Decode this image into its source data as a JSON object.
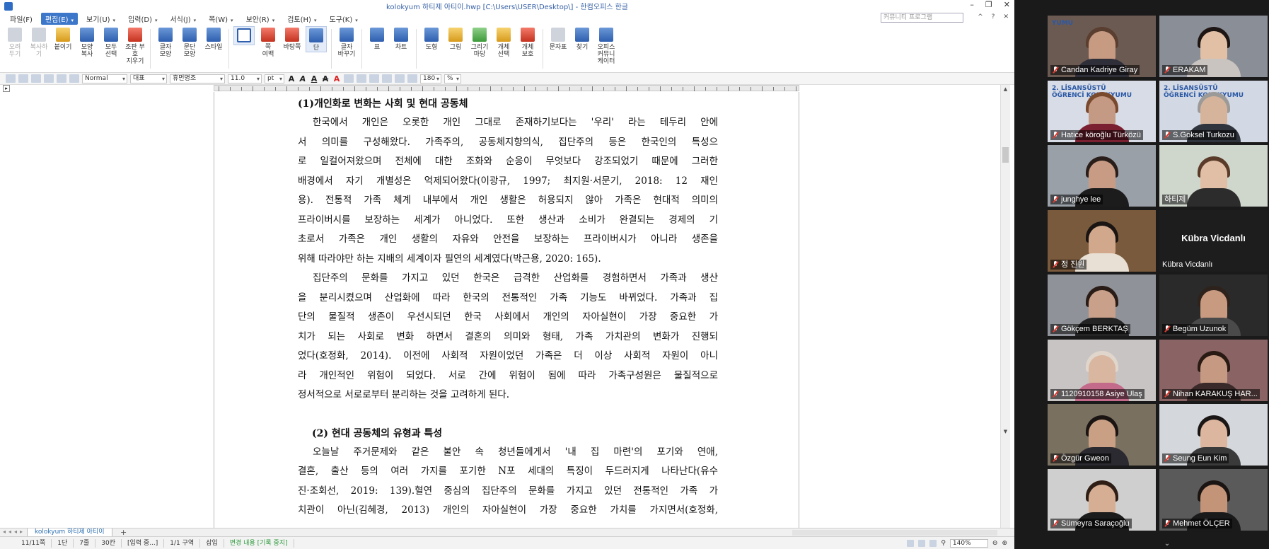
{
  "window": {
    "title": "kolokyum 하티제 아티이.hwp [C:\\Users\\USER\\Desktop\\] - 한컴오피스 한글",
    "controls": [
      "–",
      "❐",
      "✕"
    ]
  },
  "menu": {
    "items": [
      "파일(F)",
      "편집(E)",
      "보기(U)",
      "입력(D)",
      "서식(J)",
      "쪽(W)",
      "보안(R)",
      "검토(H)",
      "도구(K)"
    ],
    "active_index": 1,
    "community_placeholder": "커뮤니티 프로그램",
    "mini_controls": [
      "^",
      "?",
      "✕"
    ]
  },
  "ribbon": {
    "buttons": [
      {
        "label": "오려\n두기",
        "icon": "scissors-icon",
        "color": "gray",
        "disabled": true
      },
      {
        "label": "복사하기",
        "icon": "copy-icon",
        "color": "gray",
        "disabled": true
      },
      {
        "label": "붙이기",
        "icon": "paste-icon",
        "color": "gold"
      },
      {
        "label": "모양\n복사",
        "icon": "format-painter-icon",
        "color": "blue"
      },
      {
        "label": "모두\n선택",
        "icon": "select-all-icon",
        "color": "blue"
      },
      {
        "label": "조판 부호\n지우기",
        "icon": "erase-codes-icon",
        "color": "red"
      },
      {
        "sep": true
      },
      {
        "label": "글자\n모양",
        "icon": "char-shape-icon",
        "color": "blue"
      },
      {
        "label": "문단\n모양",
        "icon": "para-shape-icon",
        "color": "blue"
      },
      {
        "label": "스타일",
        "icon": "style-icon",
        "color": "blue"
      },
      {
        "sep": true
      },
      {
        "label": "",
        "icon": "page-layout-icon",
        "color": "outline",
        "selected": true
      },
      {
        "label": "쪽\n여백",
        "icon": "page-margin-icon",
        "color": "red"
      },
      {
        "label": "바탕쪽",
        "icon": "master-page-icon",
        "color": "red"
      },
      {
        "label": "단",
        "icon": "columns-icon",
        "color": "blue",
        "selected": true
      },
      {
        "sep": true
      },
      {
        "label": "글자\n바꾸기",
        "icon": "replace-char-icon",
        "color": "blue"
      },
      {
        "sep": true
      },
      {
        "label": "표",
        "icon": "table-icon",
        "color": "blue"
      },
      {
        "label": "차트",
        "icon": "chart-icon",
        "color": "blue"
      },
      {
        "sep": true
      },
      {
        "label": "도형",
        "icon": "shape-icon",
        "color": "blue"
      },
      {
        "label": "그림",
        "icon": "picture-icon",
        "color": "gold"
      },
      {
        "label": "그리기마당",
        "icon": "drawing-gallery-icon",
        "color": "green"
      },
      {
        "label": "개체\n선택",
        "icon": "object-select-icon",
        "color": "gold"
      },
      {
        "label": "개체\n보호",
        "icon": "object-protect-icon",
        "color": "red"
      },
      {
        "sep": true
      },
      {
        "label": "문자표",
        "icon": "symbol-icon",
        "color": "gray"
      },
      {
        "label": "찾기",
        "icon": "find-icon",
        "color": "blue"
      },
      {
        "label": "오피스\n커뮤니케이터",
        "icon": "communicator-icon",
        "color": "blue"
      }
    ]
  },
  "formatbar": {
    "style": "Normal",
    "lang": "대표",
    "font": "휴먼명조",
    "size": "11.0",
    "unit": "pt",
    "glyphs": [
      "A",
      "A",
      "A",
      "A",
      "A"
    ],
    "zoom": "180",
    "zoom_unit": "%"
  },
  "document": {
    "heading1": "(1)개인화로 변화는 사회 및 현대 공동체",
    "para1": [
      "한국에서 개인은 오롯한 개인 그대로 존재하기보다는 '우리' 라는 테두리 안에",
      "서 의미를 구성해왔다. 가족주의, 공동체지향의식, 집단주의 등은 한국인의 특성으",
      "로 일컬어져왔으며 전체에 대한 조화와 순응이 무엇보다 강조되었기 때문에 그러한",
      "배경에서 자기 개별성은 억제되어왔다(이광규, 1997; 최지원·서문기, 2018: 12 재인",
      "용). 전통적 가족 체계 내부에서 개인 생활은 허용되지 않아 가족은 현대적 의미의",
      "프라이버시를 보장하는 세계가 아니었다. 또한 생산과 소비가 완결되는 경제의 기",
      "초로서 가족은 개인 생활의 자유와 안전을 보장하는 프라이버시가 아니라 생존을",
      "위해 따라야만 하는 지배의 세계이자 필연의 세계였다(박근용, 2020: 165)."
    ],
    "para2": [
      "집단주의 문화를 가지고 있던 한국은 급격한 산업화를 경험하면서 가족과 생산",
      "을 분리시켰으며 산업화에 따라 한국의 전통적인 가족 기능도 바뀌었다. 가족과 집",
      "단의 물질적 생존이 우선시되던 한국 사회에서 개인의 자아실현이 가장 중요한 가",
      "치가 되는 사회로 변화 하면서 결혼의 의미와 형태, 가족 가치관의 변화가 진행되",
      "었다(호정화, 2014). 이전에 사회적 자원이었던 가족은 더 이상 사회적 자원이 아니",
      "라 개인적인 위험이 되었다. 서로 간에 위험이 됨에 따라 가족구성원은 물질적으로",
      "정서적으로 서로로부터 분리하는 것을 고려하게 된다."
    ],
    "heading2": "(2) 현대 공동체의 유형과 특성",
    "para3": [
      "오늘날 주거문제와 같은 불안 속 청년들에게서 '내 집 마련'의 포기와 연애,",
      "결혼, 출산 등의 여러 가지를 포기한 N포 세대의 특징이 두드러지게 나타난다(유수",
      "진·조회선, 2019: 139).혈연 중심의 집단주의 문화를 가지고 있던 전통적인 가족 가",
      "치관이 아닌(김혜경, 2013) 개인의 자아실현이 가장 중요한 가치를 가지면서(호정화,"
    ]
  },
  "tabbar": {
    "doc_tab": "kolokyum 하티제 아티이",
    "nav": "◂◂◂▸",
    "add": "+"
  },
  "status": {
    "segments": [
      "11/11쪽",
      "1단",
      "7줄",
      "30칸",
      "[입력 중...]",
      "1/1 구역",
      "삽입"
    ],
    "changes": "변경 내용 [기록 중지]",
    "zoom": "140%"
  },
  "participants": [
    {
      "name": "Candan Kadriye Giray",
      "muted": true,
      "bg": "#6b5a52",
      "skin": "#c79a82",
      "hair": "#5a3e30",
      "shirt": "#2f2f3a",
      "banner": "YUMU"
    },
    {
      "name": "ERAKAM",
      "muted": true,
      "bg": "#8a8e96",
      "skin": "#e2c0a6",
      "hair": "#1e1614",
      "shirt": "#c9c4c0"
    },
    {
      "name": "Hatice köroğlu Türközü",
      "muted": true,
      "bg": "#d7dce6",
      "skin": "#c49a84",
      "hair": "#7a4a2e",
      "shirt": "#7a2030",
      "banner": "2. LİSANSÜSTÜ\nÖĞRENCİ KOLOKYUMU"
    },
    {
      "name": "S.Goksel Turkozu",
      "muted": true,
      "bg": "#d3d9e4",
      "skin": "#d6b49c",
      "hair": "#9c9a98",
      "shirt": "#30343c",
      "banner": "2. LİSANSÜSTÜ\nÖĞRENCİ KOLOKYUMU"
    },
    {
      "name": "junghye lee",
      "muted": true,
      "bg": "#9aa0a8",
      "skin": "#c89c84",
      "hair": "#2a1e1a",
      "shirt": "#1c1c1c"
    },
    {
      "name": "하티제",
      "muted": false,
      "bg": "#cfd6cc",
      "skin": "#e0bfa6",
      "hair": "#5a3a28",
      "shirt": "#2c2c2c",
      "speaking": true
    },
    {
      "name": "정 진원",
      "muted": true,
      "bg": "#7a5a3c",
      "skin": "#d1a88c",
      "hair": "#1a1412",
      "shirt": "#e8e0d4"
    },
    {
      "name": "Kübra Vicdanlı",
      "muted": false,
      "blank": true
    },
    {
      "name": "Gökçem BERKTAŞ",
      "muted": true,
      "bg": "#8f9298",
      "skin": "#c9a08a",
      "hair": "#2a1c16",
      "shirt": "#242424"
    },
    {
      "name": "Begüm Uzunok",
      "muted": true,
      "bg": "#2a2a2a",
      "skin": "#c89a80",
      "hair": "#2e221c",
      "shirt": "#4a4a4a"
    },
    {
      "name": "1120910158 Asiye Ulaş",
      "muted": true,
      "bg": "#c8c4c4",
      "skin": "#d8b6a0",
      "hair": "#e0d6cc",
      "shirt": "#c46a8a"
    },
    {
      "name": "Nihan KARAKUŞ HAR...",
      "muted": true,
      "bg": "#8a6464",
      "skin": "#c69a82",
      "hair": "#2a1a14",
      "shirt": "#3a2a2a"
    },
    {
      "name": "Özgür Gweon",
      "muted": true,
      "bg": "#7a7060",
      "skin": "#caa084",
      "hair": "#1a1412",
      "shirt": "#2a2a30"
    },
    {
      "name": "Seung Eun Kim",
      "muted": true,
      "bg": "#d4d8dc",
      "skin": "#dcb69e",
      "hair": "#1a1616",
      "shirt": "#3a3a3a"
    },
    {
      "name": "Sümeyra Saraçoğlu",
      "muted": true,
      "bg": "#cfcfcf",
      "skin": "#d6ae94",
      "hair": "#2e1e16",
      "shirt": "#1c1c1c"
    },
    {
      "name": "Mehmet ÖLÇER",
      "muted": true,
      "bg": "#5a5a5a",
      "skin": "#c49478",
      "hair": "#1a1412",
      "shirt": "#1a1a1a"
    }
  ],
  "zoom_panel": {
    "more_icon": "⌄"
  }
}
